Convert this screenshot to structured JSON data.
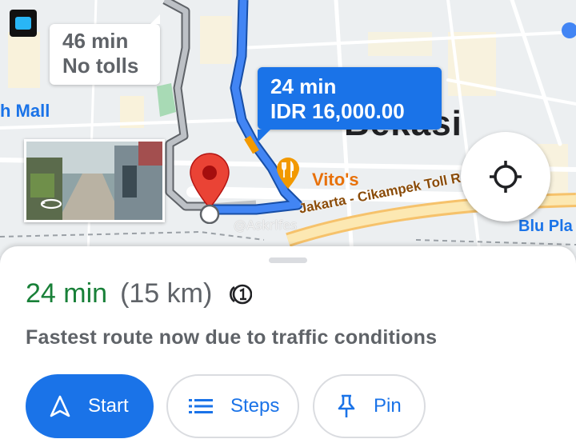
{
  "map": {
    "alt_route": {
      "time": "46 min",
      "note": "No tolls"
    },
    "main_route": {
      "time": "24 min",
      "cost": "IDR 16,000.00"
    },
    "labels": {
      "city": "Bekasi",
      "mall": "h Mall",
      "restaurant": "Vito's",
      "road": "Jakarta - Cikampek Toll Rd",
      "blu": "Blu Pla",
      "watermark": "@Askrlfes"
    },
    "icons": {
      "app": "app-icon",
      "destination_pin": "red-pin-icon",
      "restaurant": "fork-knife-icon",
      "street_view": "360-rotate-icon",
      "locate": "my-location-icon"
    },
    "colors": {
      "route": "#1a73e8",
      "alt_route": "#9aa0a6",
      "pin": "#ea4335",
      "traffic": "#f29900"
    }
  },
  "sheet": {
    "eta": "24 min",
    "distance": "(15 km)",
    "toll_icon": "toll-icon",
    "description": "Fastest route now due to traffic conditions",
    "buttons": {
      "start": "Start",
      "steps": "Steps",
      "pin": "Pin"
    },
    "colors": {
      "eta": "#188038",
      "primary": "#1a73e8"
    }
  }
}
